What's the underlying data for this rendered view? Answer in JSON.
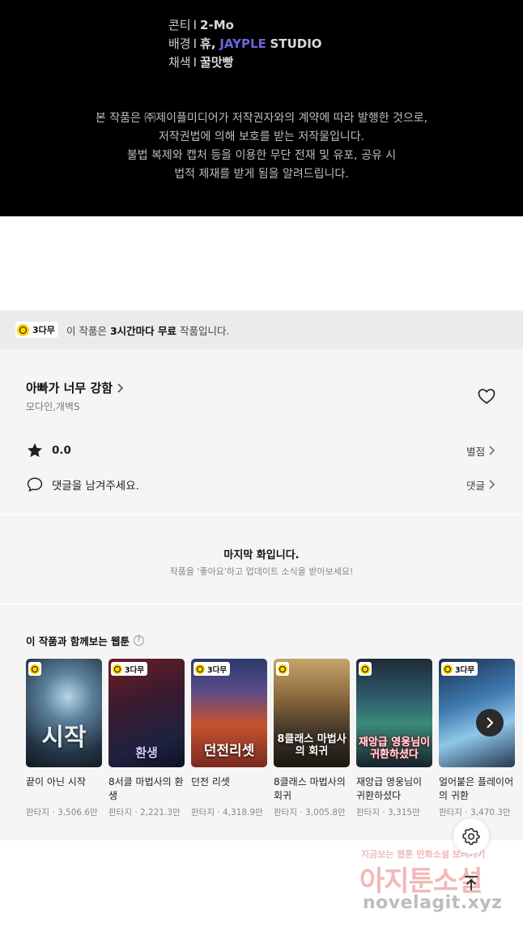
{
  "credits": {
    "lines": [
      {
        "role": "콘티",
        "sep": "I",
        "value": "2-Mo"
      },
      {
        "role": "배경",
        "sep": "I",
        "value": "휴,",
        "value_blue": "JAYPLE",
        "value_tail": "STUDIO"
      },
      {
        "role": "채색",
        "sep": "I",
        "value": "꿀맛빵"
      }
    ],
    "notice": [
      "본 작품은 ㈜제이플미디어가 저작권자와의 계약에 따라 발행한 것으로,",
      "저작권법에 의해 보호를 받는 저작물입니다.",
      "불법 복제와 캡처 등을 이용한 무단 전재 및 유포, 공유 시",
      "법적 제재를 받게 됨을 알려드립니다."
    ]
  },
  "free_bar": {
    "badge": "3다무",
    "text_pre": "이 작품은 ",
    "text_bold": "3시간마다 무료",
    "text_post": " 작품입니다."
  },
  "work": {
    "title": "아빠가 너무 강함",
    "authors": "모다인,개벽S",
    "rating": "0.0",
    "rating_link": "별점",
    "comment_prompt": "댓글을 남겨주세요.",
    "comment_link": "댓글"
  },
  "last_chapter": {
    "title": "마지막 화입니다.",
    "subtitle": "작품을 '좋아요'하고 업데이트 소식을 받아보세요!"
  },
  "recommendations": {
    "title": "이 작품과 함께보는 웹툰",
    "help": "?",
    "items": [
      {
        "title": "끝이 아닌 시작",
        "genre": "판타지",
        "views": "3,506.6만",
        "badge": "",
        "cover": "시작"
      },
      {
        "title": "8서클 마법사의 환생",
        "genre": "판타지",
        "views": "2,221.3만",
        "badge": "3다무",
        "cover": "환생"
      },
      {
        "title": "던전 리셋",
        "genre": "판타지",
        "views": "4,318.9만",
        "badge": "3다무",
        "cover": "던전리셋"
      },
      {
        "title": "8클래스 마법사의 회귀",
        "genre": "판타지",
        "views": "3,005.8만",
        "badge": "",
        "cover": "8클래스 마법사의 회귀"
      },
      {
        "title": "재앙급 영웅님이 귀환하셨다",
        "genre": "판타지",
        "views": "3,315만",
        "badge": "",
        "cover": "재앙급 영웅님이 귀환하셨다"
      },
      {
        "title": "얼어붙은 플레이어의 귀환",
        "genre": "판타지",
        "views": "3,470.3만",
        "badge": "3다무",
        "cover": ""
      }
    ],
    "meta_sep": "·"
  },
  "watermark": {
    "top_a": "지금보는 웹툰",
    "top_b": "만화소설 보러가기",
    "mid": "아지툰소설",
    "bottom": "novelagit.xyz"
  },
  "colors": {
    "badge_yellow": "#ffd200",
    "credit_blue": "#6b66d8",
    "bar_bg": "#ebebeb",
    "section_bg": "#f5f5f5"
  },
  "icons": [
    "clock-icon",
    "chevron-right-icon",
    "heart-icon",
    "star-icon",
    "comment-icon",
    "settings-icon",
    "arrow-up-icon",
    "question-icon"
  ]
}
